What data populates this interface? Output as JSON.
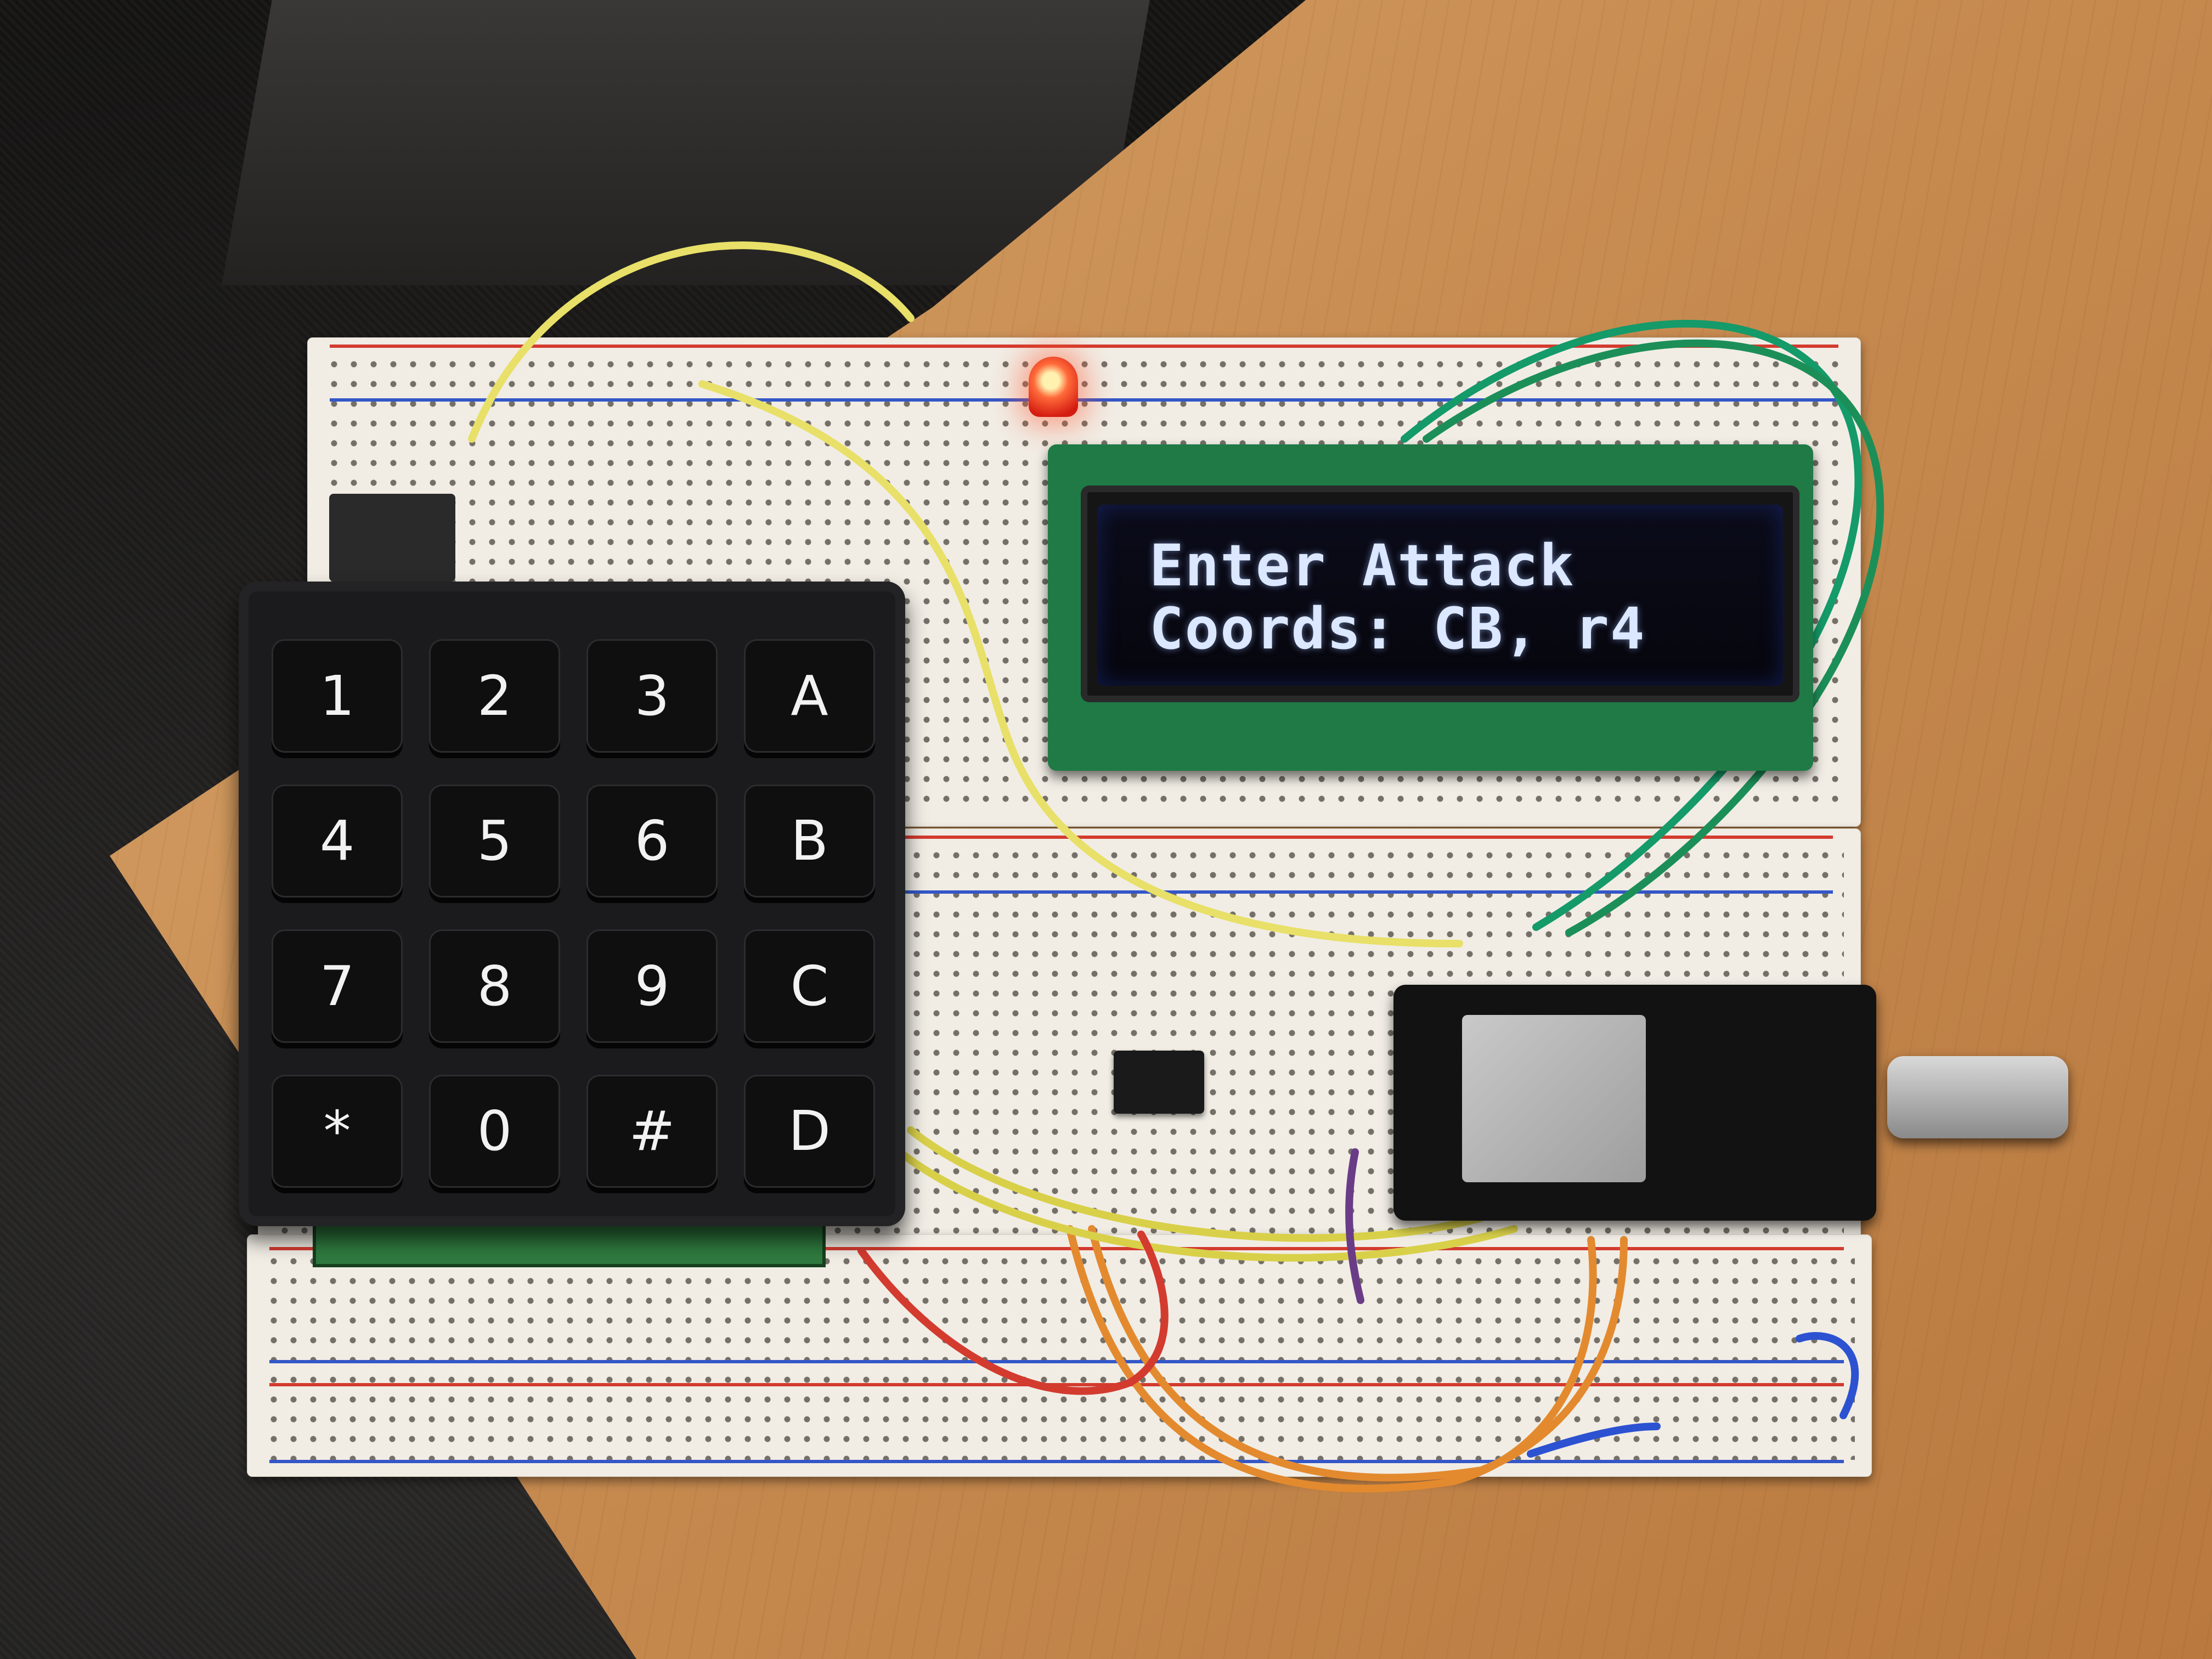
{
  "scene": {
    "lcd": {
      "line1": "Enter Attack",
      "line2": "Coords: CB, r4"
    },
    "keypad": {
      "keys": [
        "1",
        "2",
        "3",
        "A",
        "4",
        "5",
        "6",
        "B",
        "7",
        "8",
        "9",
        "C",
        "*",
        "0",
        "#",
        "D"
      ]
    },
    "colors": {
      "wood": "#c88d52",
      "breadboard": "#f1ede5",
      "keypad": "#1b1b1d",
      "lcd_text": "#dbe8ff",
      "lcd_bg": "#0b0c1a",
      "pcb_green": "#1f7a45",
      "led_red": "#ff4a2a"
    }
  }
}
